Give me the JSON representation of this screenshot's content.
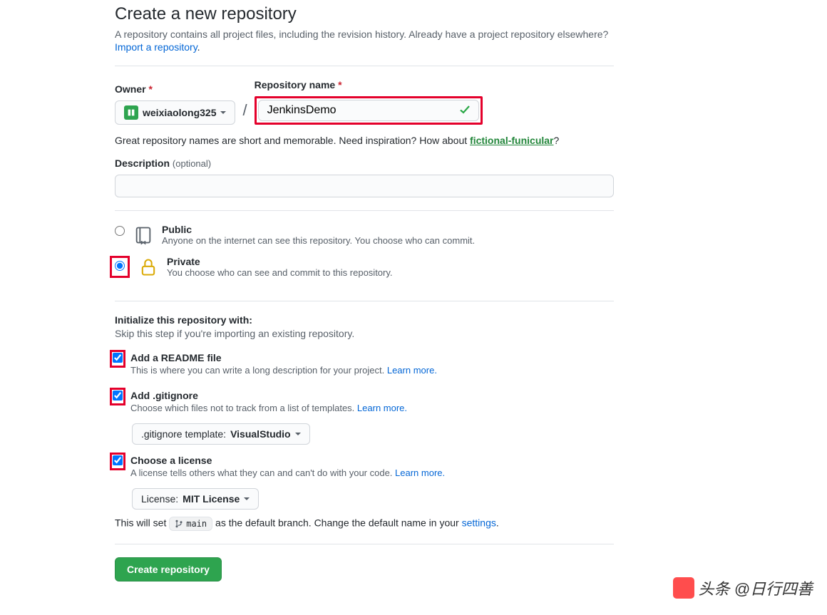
{
  "header": {
    "title": "Create a new repository",
    "subtitle": "A repository contains all project files, including the revision history. Already have a project repository elsewhere?",
    "import_link": "Import a repository"
  },
  "owner": {
    "label": "Owner",
    "selected": "weixiaolong325"
  },
  "repo": {
    "label": "Repository name",
    "value": "JenkinsDemo"
  },
  "help": {
    "prefix": "Great repository names are short and memorable. Need inspiration? How about ",
    "suggestion": "fictional-funicular",
    "suffix": "?"
  },
  "description": {
    "label": "Description",
    "optional": "(optional)",
    "value": ""
  },
  "visibility": {
    "public": {
      "title": "Public",
      "desc": "Anyone on the internet can see this repository. You choose who can commit."
    },
    "private": {
      "title": "Private",
      "desc": "You choose who can see and commit to this repository."
    }
  },
  "init": {
    "heading": "Initialize this repository with:",
    "skip": "Skip this step if you're importing an existing repository."
  },
  "readme": {
    "title": "Add a README file",
    "desc": "This is where you can write a long description for your project. ",
    "learn": "Learn more."
  },
  "gitignore": {
    "title": "Add .gitignore",
    "desc": "Choose which files not to track from a list of templates. ",
    "learn": "Learn more.",
    "dd_label": ".gitignore template: ",
    "dd_value": "VisualStudio"
  },
  "license": {
    "title": "Choose a license",
    "desc": "A license tells others what they can and can't do with your code. ",
    "learn": "Learn more.",
    "dd_label": "License: ",
    "dd_value": "MIT License"
  },
  "branch": {
    "pre": "This will set ",
    "name": "main",
    "post": " as the default branch. Change the default name in your ",
    "settings": "settings",
    "period": "."
  },
  "submit": {
    "label": "Create repository"
  },
  "watermark": {
    "text": "头条 @日行四善"
  }
}
